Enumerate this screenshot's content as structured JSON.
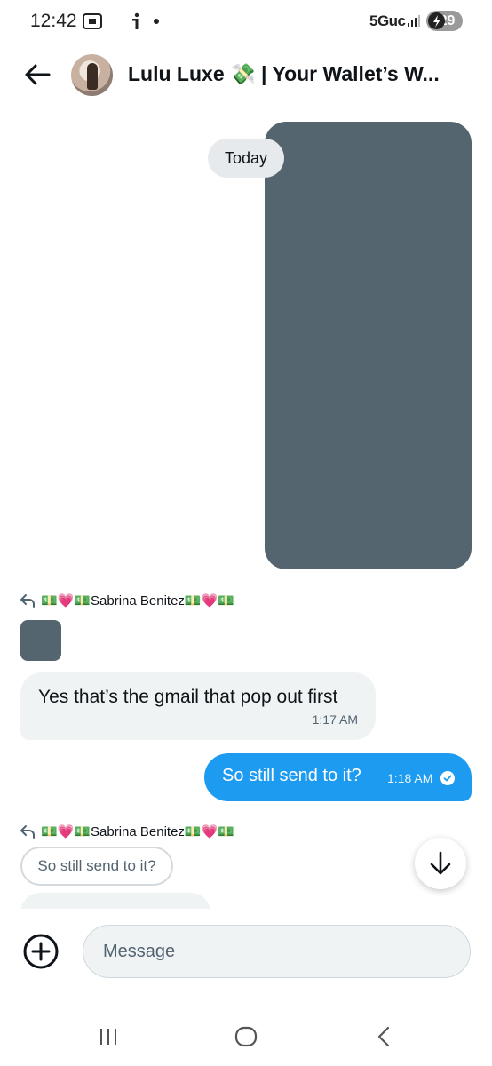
{
  "status_bar": {
    "time": "12:42",
    "network": "5Guc",
    "battery": "29"
  },
  "header": {
    "title": "Lulu Luxe 💸 | Your Wallet’s W..."
  },
  "chat": {
    "date_chip": "Today",
    "reply_ref_1": "💵💗💵Sabrina Benitez💵💗💵",
    "incoming_message": {
      "text": "Yes that’s the gmail that pop out first",
      "time": "1:17 AM"
    },
    "outgoing_message": {
      "text": "So still send to it?",
      "time": "1:18 AM"
    },
    "reply_ref_2": "💵💗💵Sabrina Benitez💵💗💵",
    "quoted_text": "So still send to it?"
  },
  "composer": {
    "placeholder": "Message"
  },
  "colors": {
    "accent": "#1d9bf0",
    "incoming_bubble": "#eff3f4",
    "media_placeholder": "#546570"
  },
  "icons": {
    "back": "arrow-left-icon",
    "add": "plus-circle-icon",
    "scroll": "arrow-down-icon",
    "sent": "check-circle-icon",
    "reply": "reply-arrow-icon"
  }
}
